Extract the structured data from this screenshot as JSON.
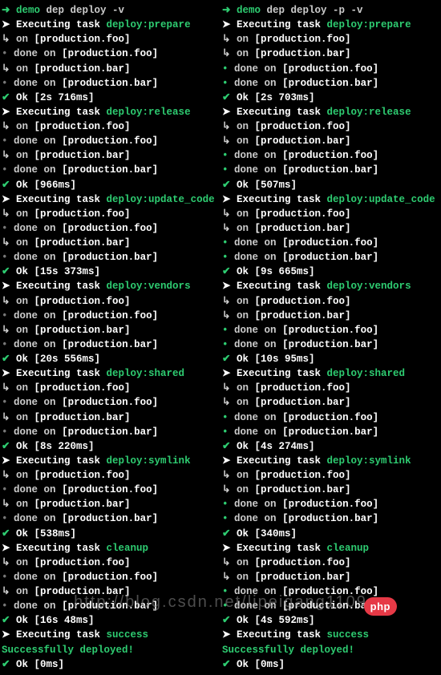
{
  "left": {
    "prompt": {
      "arrow": "➜",
      "label": "demo",
      "command": "dep deploy -v"
    },
    "sections": [
      {
        "task": "deploy:prepare",
        "lines": [
          {
            "t": "on",
            "s": "[production.foo]"
          },
          {
            "t": "done",
            "s": "[production.foo]"
          },
          {
            "t": "on",
            "s": "[production.bar]"
          },
          {
            "t": "done",
            "s": "[production.bar]"
          }
        ],
        "ok": "Ok [2s 716ms]"
      },
      {
        "task": "deploy:release",
        "lines": [
          {
            "t": "on",
            "s": "[production.foo]"
          },
          {
            "t": "done",
            "s": "[production.foo]"
          },
          {
            "t": "on",
            "s": "[production.bar]"
          },
          {
            "t": "done",
            "s": "[production.bar]"
          }
        ],
        "ok": "Ok [966ms]"
      },
      {
        "task": "deploy:update_code",
        "lines": [
          {
            "t": "on",
            "s": "[production.foo]"
          },
          {
            "t": "done",
            "s": "[production.foo]"
          },
          {
            "t": "on",
            "s": "[production.bar]"
          },
          {
            "t": "done",
            "s": "[production.bar]"
          }
        ],
        "ok": "Ok [15s 373ms]"
      },
      {
        "task": "deploy:vendors",
        "lines": [
          {
            "t": "on",
            "s": "[production.foo]"
          },
          {
            "t": "done",
            "s": "[production.foo]"
          },
          {
            "t": "on",
            "s": "[production.bar]"
          },
          {
            "t": "done",
            "s": "[production.bar]"
          }
        ],
        "ok": "Ok [20s 556ms]"
      },
      {
        "task": "deploy:shared",
        "lines": [
          {
            "t": "on",
            "s": "[production.foo]"
          },
          {
            "t": "done",
            "s": "[production.foo]"
          },
          {
            "t": "on",
            "s": "[production.bar]"
          },
          {
            "t": "done",
            "s": "[production.bar]"
          }
        ],
        "ok": "Ok [8s 220ms]"
      },
      {
        "task": "deploy:symlink",
        "lines": [
          {
            "t": "on",
            "s": "[production.foo]"
          },
          {
            "t": "done",
            "s": "[production.foo]"
          },
          {
            "t": "on",
            "s": "[production.bar]"
          },
          {
            "t": "done",
            "s": "[production.bar]"
          }
        ],
        "ok": "Ok [538ms]"
      },
      {
        "task": "cleanup",
        "lines": [
          {
            "t": "on",
            "s": "[production.foo]"
          },
          {
            "t": "done",
            "s": "[production.foo]"
          },
          {
            "t": "on",
            "s": "[production.bar]"
          },
          {
            "t": "done",
            "s": "[production.bar]"
          }
        ],
        "ok": "Ok [16s 48ms]"
      },
      {
        "task": "success",
        "lines": [],
        "ok": null
      }
    ],
    "success": "Successfully deployed!",
    "final_ok": "Ok [0ms]"
  },
  "right": {
    "prompt": {
      "arrow": "➜",
      "label": "demo",
      "command": "dep deploy -p -v"
    },
    "sections": [
      {
        "task": "deploy:prepare",
        "lines": [
          {
            "t": "on",
            "s": "[production.foo]"
          },
          {
            "t": "on",
            "s": "[production.bar]"
          },
          {
            "t": "done",
            "s": "[production.foo]"
          },
          {
            "t": "done",
            "s": "[production.bar]"
          }
        ],
        "ok": "Ok [2s 703ms]"
      },
      {
        "task": "deploy:release",
        "lines": [
          {
            "t": "on",
            "s": "[production.foo]"
          },
          {
            "t": "on",
            "s": "[production.bar]"
          },
          {
            "t": "done",
            "s": "[production.foo]"
          },
          {
            "t": "done",
            "s": "[production.bar]"
          }
        ],
        "ok": "Ok [507ms]"
      },
      {
        "task": "deploy:update_code",
        "lines": [
          {
            "t": "on",
            "s": "[production.foo]"
          },
          {
            "t": "on",
            "s": "[production.bar]"
          },
          {
            "t": "done",
            "s": "[production.foo]"
          },
          {
            "t": "done",
            "s": "[production.bar]"
          }
        ],
        "ok": "Ok [9s 665ms]"
      },
      {
        "task": "deploy:vendors",
        "lines": [
          {
            "t": "on",
            "s": "[production.foo]"
          },
          {
            "t": "on",
            "s": "[production.bar]"
          },
          {
            "t": "done",
            "s": "[production.foo]"
          },
          {
            "t": "done",
            "s": "[production.bar]"
          }
        ],
        "ok": "Ok [10s 95ms]"
      },
      {
        "task": "deploy:shared",
        "lines": [
          {
            "t": "on",
            "s": "[production.foo]"
          },
          {
            "t": "on",
            "s": "[production.bar]"
          },
          {
            "t": "done",
            "s": "[production.foo]"
          },
          {
            "t": "done",
            "s": "[production.bar]"
          }
        ],
        "ok": "Ok [4s 274ms]"
      },
      {
        "task": "deploy:symlink",
        "lines": [
          {
            "t": "on",
            "s": "[production.foo]"
          },
          {
            "t": "on",
            "s": "[production.bar]"
          },
          {
            "t": "done",
            "s": "[production.foo]"
          },
          {
            "t": "done",
            "s": "[production.bar]"
          }
        ],
        "ok": "Ok [340ms]"
      },
      {
        "task": "cleanup",
        "lines": [
          {
            "t": "on",
            "s": "[production.foo]"
          },
          {
            "t": "on",
            "s": "[production.bar]"
          },
          {
            "t": "done",
            "s": "[production.foo]"
          },
          {
            "t": "done",
            "s": "[production.bar]"
          }
        ],
        "ok": "Ok [4s 592ms]"
      },
      {
        "task": "success",
        "lines": [],
        "ok": null
      }
    ],
    "success": "Successfully deployed!",
    "final_ok": "Ok [0ms]"
  },
  "strings": {
    "executing": "Executing task",
    "on": "on",
    "done": "done on"
  },
  "watermark": "http://blog.csdn.net/lipeigang1109",
  "badge": "php"
}
